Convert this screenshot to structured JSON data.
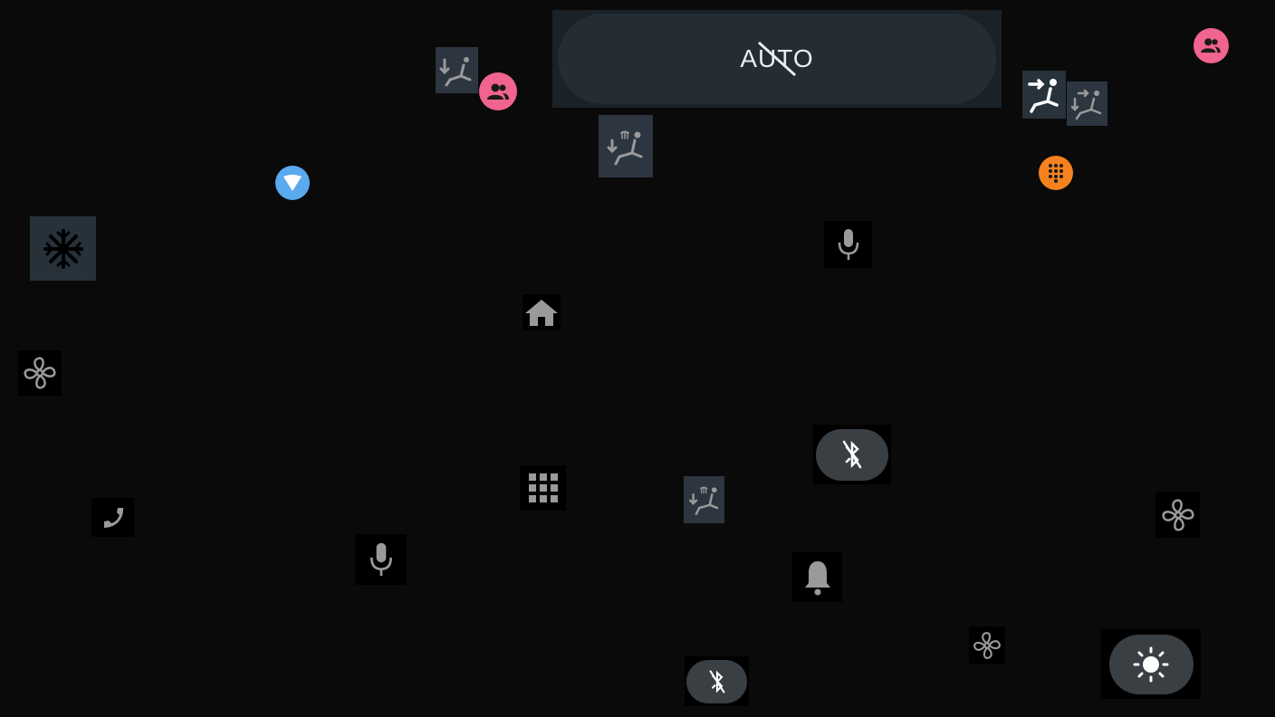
{
  "auto_button": {
    "label": "AUTO",
    "state": "off"
  },
  "colors": {
    "background": "#0a0a0a",
    "profile_pink": "#f0648f",
    "dialer_orange": "#f5821f",
    "assistant_blue": "#5aaaf0",
    "icon_gray": "#9a9a9a",
    "icon_white": "#ffffff"
  },
  "icons": [
    "seat-airflow-down-icon",
    "profile-icon",
    "seat-defrost-airflow-icon",
    "seat-airflow-face-icon",
    "seat-airflow-face-down-icon",
    "profile-icon",
    "assistant-icon",
    "dialpad-icon",
    "ac-snowflake-icon",
    "microphone-icon",
    "home-icon",
    "fan-icon",
    "bluetooth-off-icon",
    "app-grid-icon",
    "seat-defrost-airflow-icon",
    "fan-icon",
    "phone-icon",
    "microphone-icon",
    "notification-bell-icon",
    "fan-icon",
    "brightness-icon",
    "bluetooth-off-icon"
  ]
}
